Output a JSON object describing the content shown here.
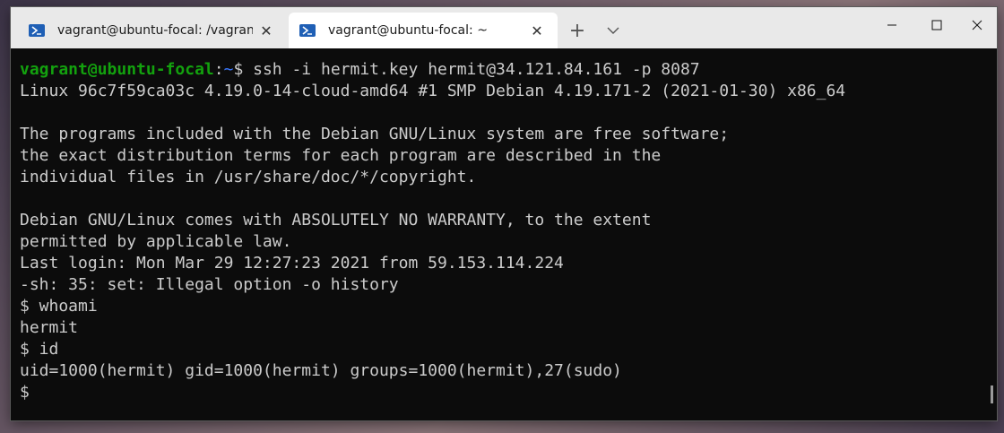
{
  "tabs": [
    {
      "title": "vagrant@ubuntu-focal: /vagrant",
      "close": "✕"
    },
    {
      "title": "vagrant@ubuntu-focal: ~",
      "close": "✕"
    }
  ],
  "toolbar": {
    "new_tab": "+",
    "dropdown_icon": "chevron-down-icon"
  },
  "window_controls": {
    "minimize": "—",
    "maximize": "☐",
    "close": "✕"
  },
  "terminal": {
    "prompt_user": "vagrant@ubuntu-focal",
    "prompt_colon": ":",
    "prompt_path": "~",
    "prompt_dollar": "$ ",
    "command": "ssh -i hermit.key hermit@34.121.84.161 -p 8087",
    "lines": [
      "Linux 96c7f59ca03c 4.19.0-14-cloud-amd64 #1 SMP Debian 4.19.171-2 (2021-01-30) x86_64",
      "",
      "The programs included with the Debian GNU/Linux system are free software;",
      "the exact distribution terms for each program are described in the",
      "individual files in /usr/share/doc/*/copyright.",
      "",
      "Debian GNU/Linux comes with ABSOLUTELY NO WARRANTY, to the extent",
      "permitted by applicable law.",
      "Last login: Mon Mar 29 12:27:23 2021 from 59.153.114.224",
      "-sh: 35: set: Illegal option -o history",
      "$ whoami",
      "hermit",
      "$ id",
      "uid=1000(hermit) gid=1000(hermit) groups=1000(hermit),27(sudo)",
      "$"
    ]
  },
  "colors": {
    "prompt_user": "#13a10e",
    "prompt_path": "#3b78ff",
    "terminal_bg": "#0c0c0c",
    "terminal_fg": "#cccccc",
    "titlebar_bg": "#e9e9e9"
  }
}
